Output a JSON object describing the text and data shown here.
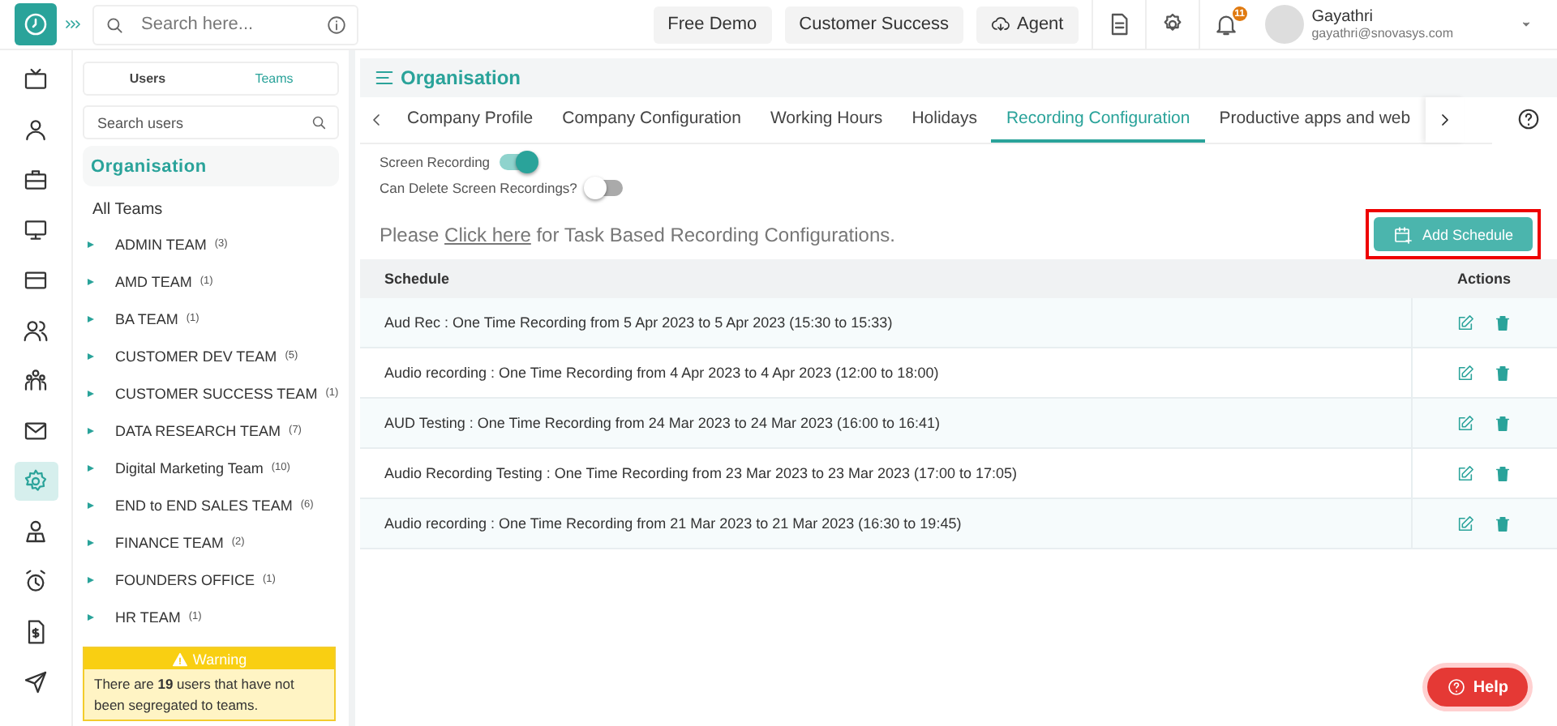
{
  "topbar": {
    "search": {
      "placeholder": "Search here..."
    },
    "buttons": [
      {
        "label": "Free Demo",
        "kind": "plain"
      },
      {
        "label": "Customer Success",
        "kind": "plain"
      },
      {
        "label": "Agent",
        "kind": "cloud"
      }
    ],
    "notifications": "11",
    "user": {
      "name": "Gayathri",
      "email": "gayathri@snovasys.com"
    }
  },
  "rail": [
    {
      "kind": "tv",
      "selected": false
    },
    {
      "kind": "user",
      "selected": false
    },
    {
      "kind": "briefcase",
      "selected": false
    },
    {
      "kind": "monitor",
      "selected": false
    },
    {
      "kind": "card",
      "selected": false
    },
    {
      "kind": "users",
      "selected": false
    },
    {
      "kind": "team",
      "selected": false
    },
    {
      "kind": "mail",
      "selected": false
    },
    {
      "kind": "gear",
      "selected": true
    },
    {
      "kind": "person",
      "selected": false
    },
    {
      "kind": "alarm",
      "selected": false
    },
    {
      "kind": "invoice",
      "selected": false
    },
    {
      "kind": "send",
      "selected": false
    }
  ],
  "sidebar": {
    "tabs": [
      {
        "label": "Users",
        "selected": false
      },
      {
        "label": "Teams",
        "selected": true
      }
    ],
    "search": {
      "placeholder": "Search users"
    },
    "heading": "Organisation",
    "all_teams": "All Teams",
    "teams": [
      {
        "name": "ADMIN TEAM",
        "count": "(3)"
      },
      {
        "name": "AMD TEAM",
        "count": "(1)"
      },
      {
        "name": "BA TEAM",
        "count": "(1)"
      },
      {
        "name": "CUSTOMER DEV TEAM",
        "count": "(5)"
      },
      {
        "name": "CUSTOMER SUCCESS TEAM",
        "count": "(1)"
      },
      {
        "name": "DATA RESEARCH TEAM",
        "count": "(7)"
      },
      {
        "name": "Digital Marketing Team",
        "count": "(10)"
      },
      {
        "name": "END to END SALES TEAM",
        "count": "(6)"
      },
      {
        "name": "FINANCE TEAM",
        "count": "(2)"
      },
      {
        "name": "FOUNDERS OFFICE",
        "count": "(1)"
      },
      {
        "name": "HR TEAM",
        "count": "(1)"
      }
    ],
    "warning": {
      "title": "Warning",
      "text": "There are **19** users that have not been segregated to teams."
    }
  },
  "main": {
    "title": "Organisation",
    "tabs": [
      {
        "label": "Company Profile",
        "selected": false
      },
      {
        "label": "Company Configuration",
        "selected": false
      },
      {
        "label": "Working Hours",
        "selected": false
      },
      {
        "label": "Holidays",
        "selected": false
      },
      {
        "label": "Recording Configuration",
        "selected": true
      },
      {
        "label": "Productive apps and web",
        "selected": false
      }
    ],
    "toggles": [
      {
        "label": "Screen Recording",
        "on": true
      },
      {
        "label": "Can Delete Screen Recordings?",
        "on": false
      }
    ],
    "notice": {
      "before": "Please ",
      "link": "Click here",
      "after": " for Task Based Recording Configurations."
    },
    "add_schedule": {
      "label": "Add Schedule",
      "highlighted": true
    },
    "table": {
      "columns": [
        "Schedule",
        "Actions"
      ],
      "rows": [
        {
          "schedule": "Aud Rec : One Time Recording from 5 Apr 2023 to 5 Apr 2023 (15:30 to 15:33)"
        },
        {
          "schedule": "Audio recording : One Time Recording from 4 Apr 2023 to 4 Apr 2023 (12:00 to 18:00)"
        },
        {
          "schedule": "AUD Testing : One Time Recording from 24 Mar 2023 to 24 Mar 2023 (16:00 to 16:41)"
        },
        {
          "schedule": "Audio Recording Testing : One Time Recording from 23 Mar 2023 to 23 Mar 2023 (17:00 to 17:05)"
        },
        {
          "schedule": "Audio recording : One Time Recording from 21 Mar 2023 to 21 Mar 2023 (16:30 to 19:45)"
        }
      ]
    }
  },
  "help": {
    "label": "Help"
  }
}
